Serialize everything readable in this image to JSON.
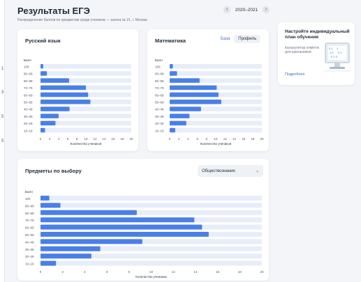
{
  "header": {
    "title": "Результаты ЕГЭ",
    "subtitle": "Распределение баллов по предметам среди учеников — школа № 21, г. Москва",
    "year": "2020–2021"
  },
  "sidebar": {
    "items": [
      "1",
      "3",
      "5",
      "5"
    ]
  },
  "cards": {
    "russian": {
      "title": "Русский язык"
    },
    "math": {
      "title": "Математика",
      "toggle_base": "База",
      "toggle_profile": "Профиль"
    },
    "elective": {
      "title": "Предметы по выбору",
      "select_value": "Обществознание"
    }
  },
  "promo": {
    "title": "Настройте индивидуальный план обучения",
    "subtitle": "Калькулятор отметок для школьников",
    "link": "Подробнее"
  },
  "colors": {
    "bar": "#4a7fe8",
    "track": "#e7edf9",
    "accent": "#3a6fd8"
  },
  "chart_data": [
    {
      "type": "bar",
      "orientation": "horizontal",
      "title": "Русский язык",
      "ytitle": "Балл",
      "xlabel": "Количество учеников",
      "categories": [
        "100",
        "90–99",
        "80–89",
        "70–79",
        "60–69",
        "50–59",
        "40–49",
        "30–39",
        "20–29",
        "10–19"
      ],
      "values": [
        0.6,
        1.4,
        6.3,
        10.0,
        10.5,
        11.0,
        6.4,
        4.0,
        3.3,
        1.0
      ],
      "xlim": [
        0,
        20
      ],
      "xticks": [
        "0",
        "2",
        "4",
        "6",
        "8",
        "10",
        "12",
        "14",
        "16",
        "18",
        "20"
      ]
    },
    {
      "type": "bar",
      "orientation": "horizontal",
      "title": "Математика",
      "ytitle": "Балл",
      "xlabel": "Количество учеников",
      "categories": [
        "100",
        "90–99",
        "80–89",
        "70–79",
        "60–69",
        "50–59",
        "40–49",
        "30–39",
        "20–29",
        "10–19"
      ],
      "values": [
        0.7,
        1.6,
        6.5,
        10.2,
        10.6,
        11.2,
        6.8,
        4.3,
        3.6,
        1.2
      ],
      "xlim": [
        0,
        20
      ],
      "xticks": [
        "0",
        "2",
        "4",
        "6",
        "8",
        "10",
        "12",
        "14",
        "16",
        "18",
        "20"
      ]
    },
    {
      "type": "bar",
      "orientation": "horizontal",
      "title": "Предметы по выбору",
      "ytitle": "Балл",
      "xlabel": "Количество учеников",
      "categories": [
        "100",
        "90–99",
        "80–89",
        "70–79",
        "60–69",
        "50–59",
        "40–49",
        "30–39",
        "20–29",
        "10–19"
      ],
      "values": [
        0.8,
        1.8,
        8.7,
        13.9,
        14.6,
        15.2,
        9.2,
        5.4,
        4.6,
        1.4
      ],
      "xlim": [
        0,
        20
      ],
      "xticks": [
        "0",
        "2",
        "4",
        "6",
        "8",
        "10",
        "12",
        "14",
        "16",
        "18",
        "20"
      ]
    }
  ]
}
